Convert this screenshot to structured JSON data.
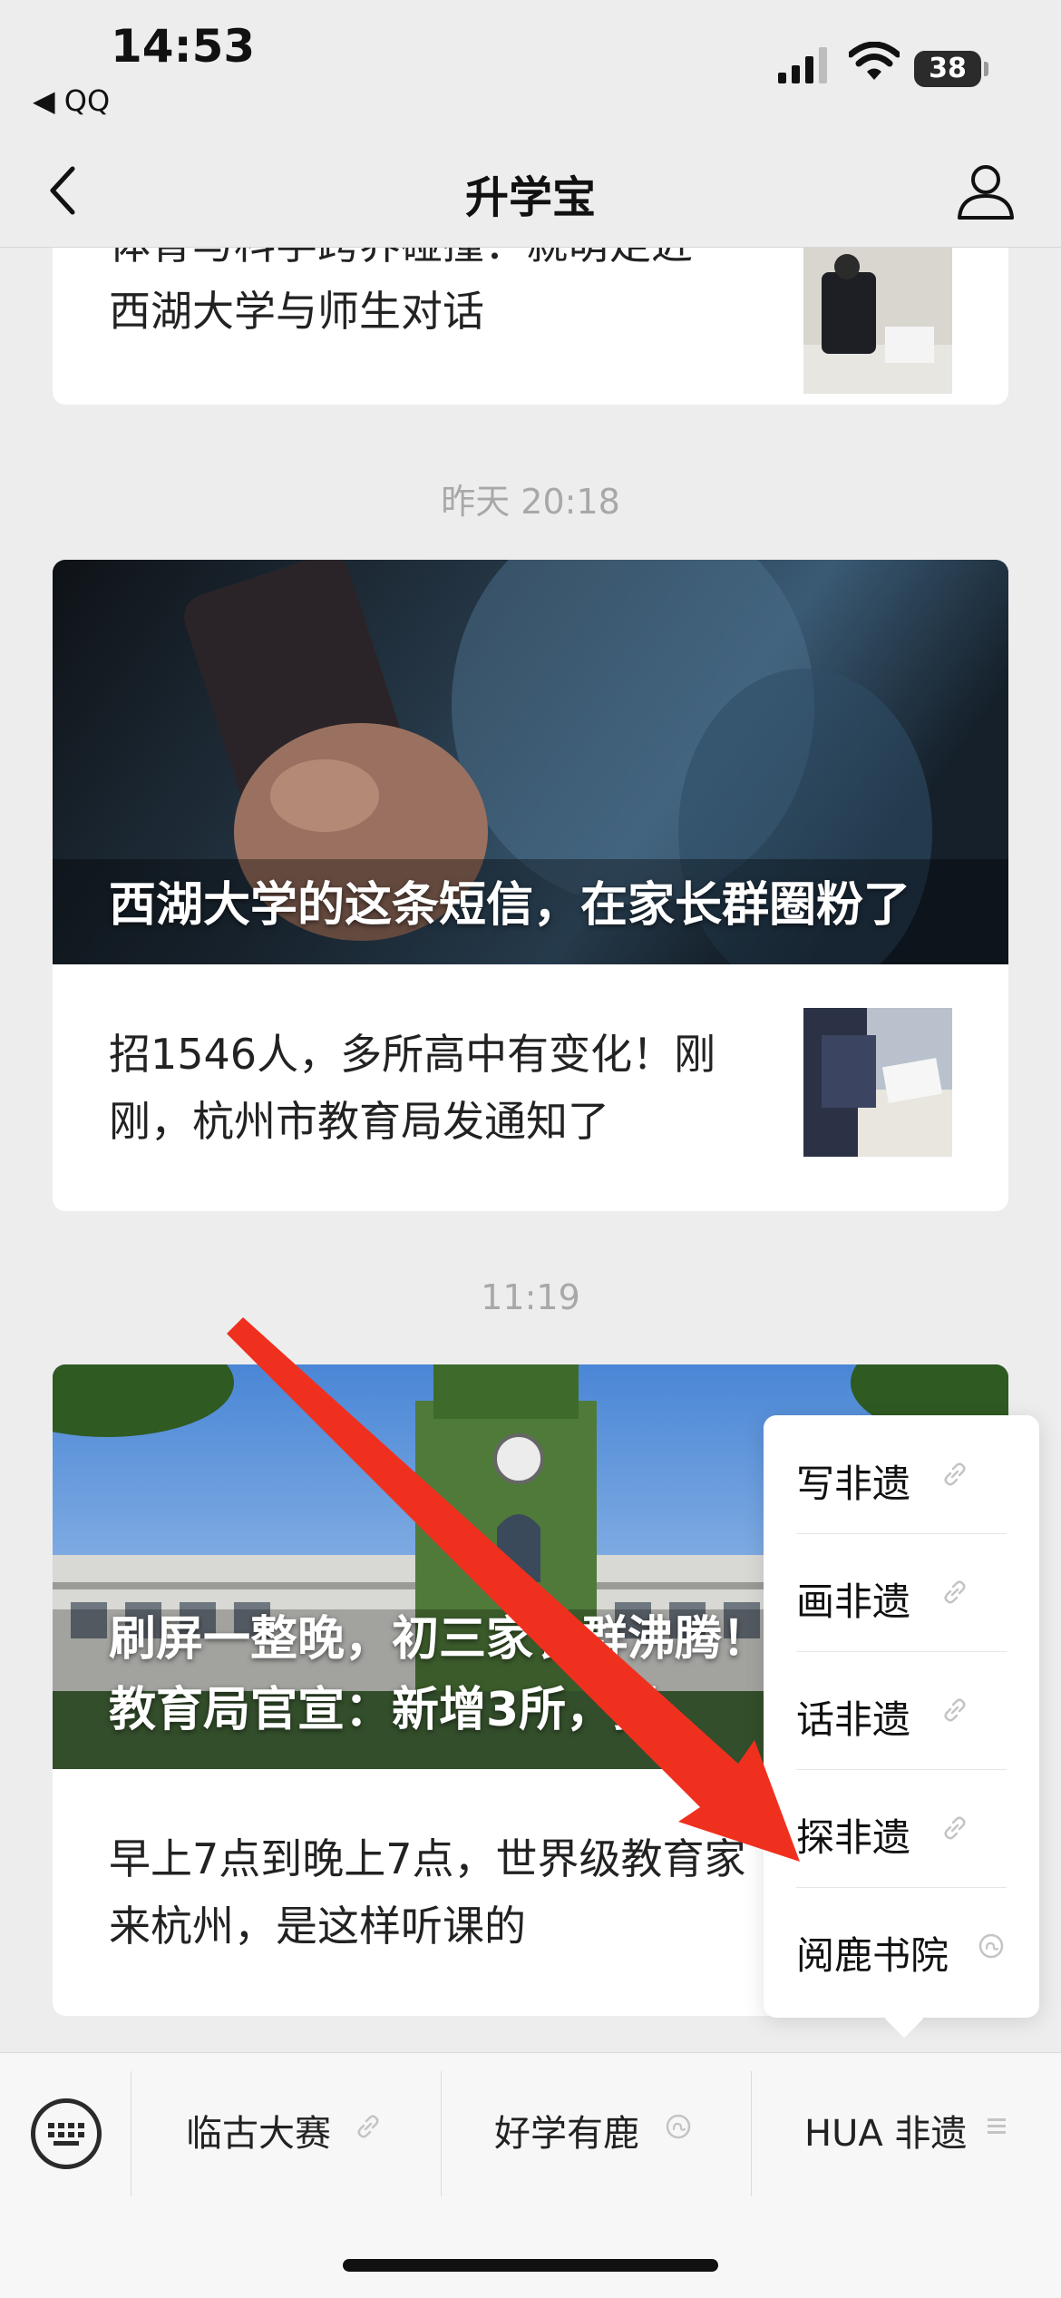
{
  "status_bar": {
    "time": "14:53",
    "back_app": "◀ QQ",
    "battery": "38"
  },
  "nav": {
    "title": "升学宝"
  },
  "feed": {
    "top_partial": {
      "line1": "体育与科学跨界碰撞：就萌走近",
      "line2": "西湖大学与师生对话"
    },
    "group1": {
      "time": "昨天 20:18",
      "hero_title": "西湖大学的这条短信，在家长群圈粉了",
      "sub_title": "招1546人，多所高中有变化！刚刚，杭州市教育局发通知了"
    },
    "group2": {
      "time": "11:19",
      "hero_title": "刷屏一整晚，初三家长群沸腾！杭州市教育局官宣：新增3所，拟",
      "sub_title": "早上7点到晚上7点，世界级教育家来杭州，是这样听课的"
    }
  },
  "popup_menu": {
    "items": [
      {
        "label": "写非遗",
        "icon": "link-icon"
      },
      {
        "label": "画非遗",
        "icon": "link-icon"
      },
      {
        "label": "话非遗",
        "icon": "link-icon"
      },
      {
        "label": "探非遗",
        "icon": "link-icon"
      },
      {
        "label": "阅鹿书院",
        "icon": "mini-program-icon"
      }
    ]
  },
  "bottom_menu": {
    "items": [
      {
        "label": "临古大赛",
        "icon": "link-icon"
      },
      {
        "label": "好学有鹿",
        "icon": "mini-program-icon"
      },
      {
        "label": "HUA 非遗",
        "icon": "list-icon"
      }
    ]
  },
  "colors": {
    "background": "#ededed",
    "card": "#ffffff",
    "annotation_arrow": "#f0301e",
    "time_label": "#a8a8a8"
  }
}
